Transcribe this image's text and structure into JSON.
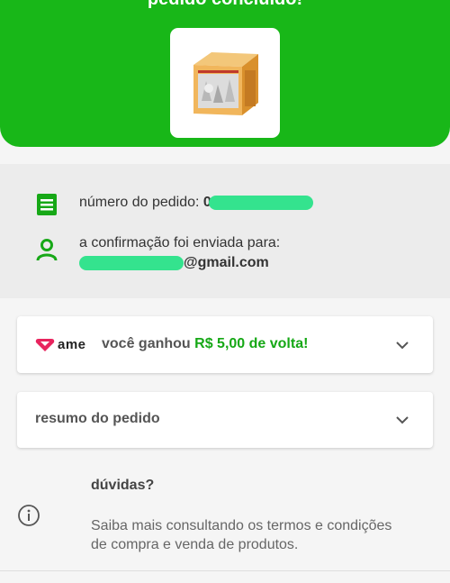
{
  "header": {
    "title": "pedido concluído!"
  },
  "order": {
    "number_label": "número do pedido:",
    "number_visible": "0",
    "confirmation_label": "a confirmação foi enviada para:",
    "email_domain": "@gmail.com"
  },
  "ame": {
    "brand": "ame",
    "message_prefix": "você ganhou",
    "cashback_value": "R$ 5,00 de volta!"
  },
  "summary": {
    "label": "resumo do pedido"
  },
  "help": {
    "title": "dúvidas?",
    "text": "Saiba mais consultando os termos e condições de compra e venda de produtos."
  },
  "colors": {
    "brand_green": "#18b718",
    "value_green": "#16a816",
    "ame_pink": "#e8245e"
  }
}
